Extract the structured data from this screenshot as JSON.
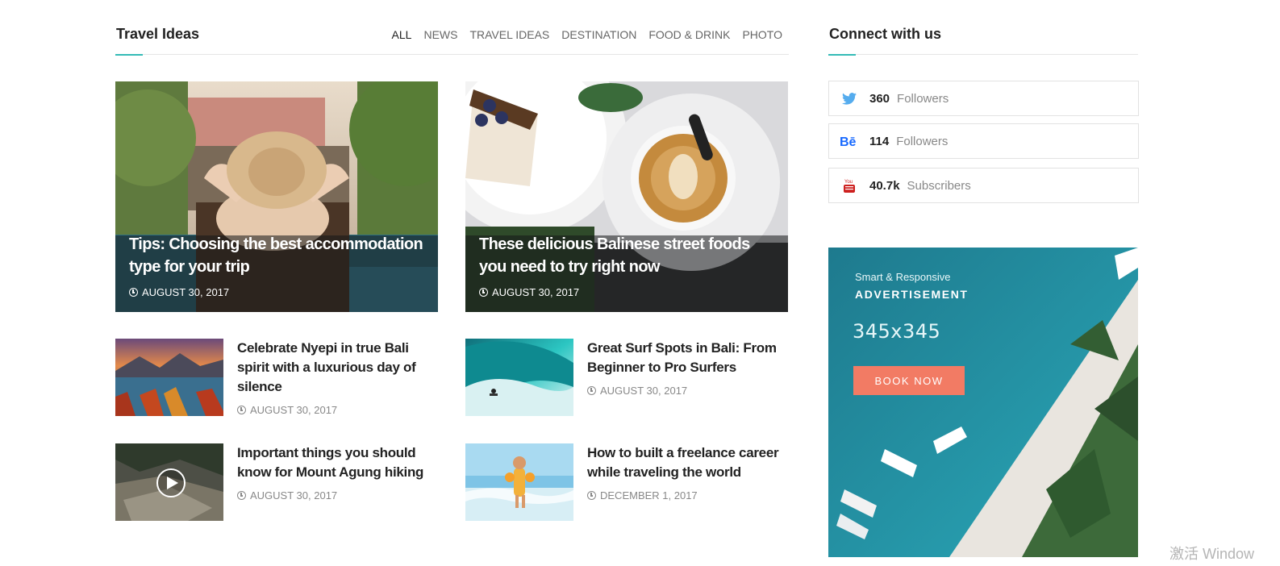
{
  "section": {
    "title": "Travel Ideas",
    "tabs": [
      "ALL",
      "NEWS",
      "TRAVEL IDEAS",
      "DESTINATION",
      "FOOD & DRINK",
      "PHOTO"
    ],
    "active_tab": "ALL"
  },
  "featured": [
    {
      "title": "Tips: Choosing the best accommodation type for your trip",
      "date": "AUGUST 30, 2017"
    },
    {
      "title": "These delicious Balinese street foods you need to try right now",
      "date": "AUGUST 30, 2017"
    }
  ],
  "posts": [
    {
      "title": "Celebrate Nyepi in true Bali spirit with a luxurious day of silence",
      "date": "AUGUST 30, 2017"
    },
    {
      "title": "Great Surf Spots in Bali: From Beginner to Pro Surfers",
      "date": "AUGUST 30, 2017"
    },
    {
      "title": "Important things you should know for Mount Agung hiking",
      "date": "AUGUST 30, 2017"
    },
    {
      "title": "How to built a freelance career while traveling the world",
      "date": "DECEMBER 1, 2017"
    }
  ],
  "sidebar": {
    "title": "Connect with us",
    "social": [
      {
        "icon": "twitter-icon",
        "count": "360",
        "label": "Followers",
        "color": "#55acee"
      },
      {
        "icon": "behance-icon",
        "count": "114",
        "label": "Followers",
        "color": "#1769ff"
      },
      {
        "icon": "youtube-icon",
        "count": "40.7k",
        "label": "Subscribers",
        "color": "#cd201f"
      }
    ],
    "ad": {
      "kicker": "Smart & Responsive",
      "headline": "ADVERTISEMENT",
      "size": "345x345",
      "button": "BOOK NOW"
    }
  },
  "watermark": "激活 Window",
  "colors": {
    "accent": "#34bbb6",
    "button": "#f27b64"
  }
}
